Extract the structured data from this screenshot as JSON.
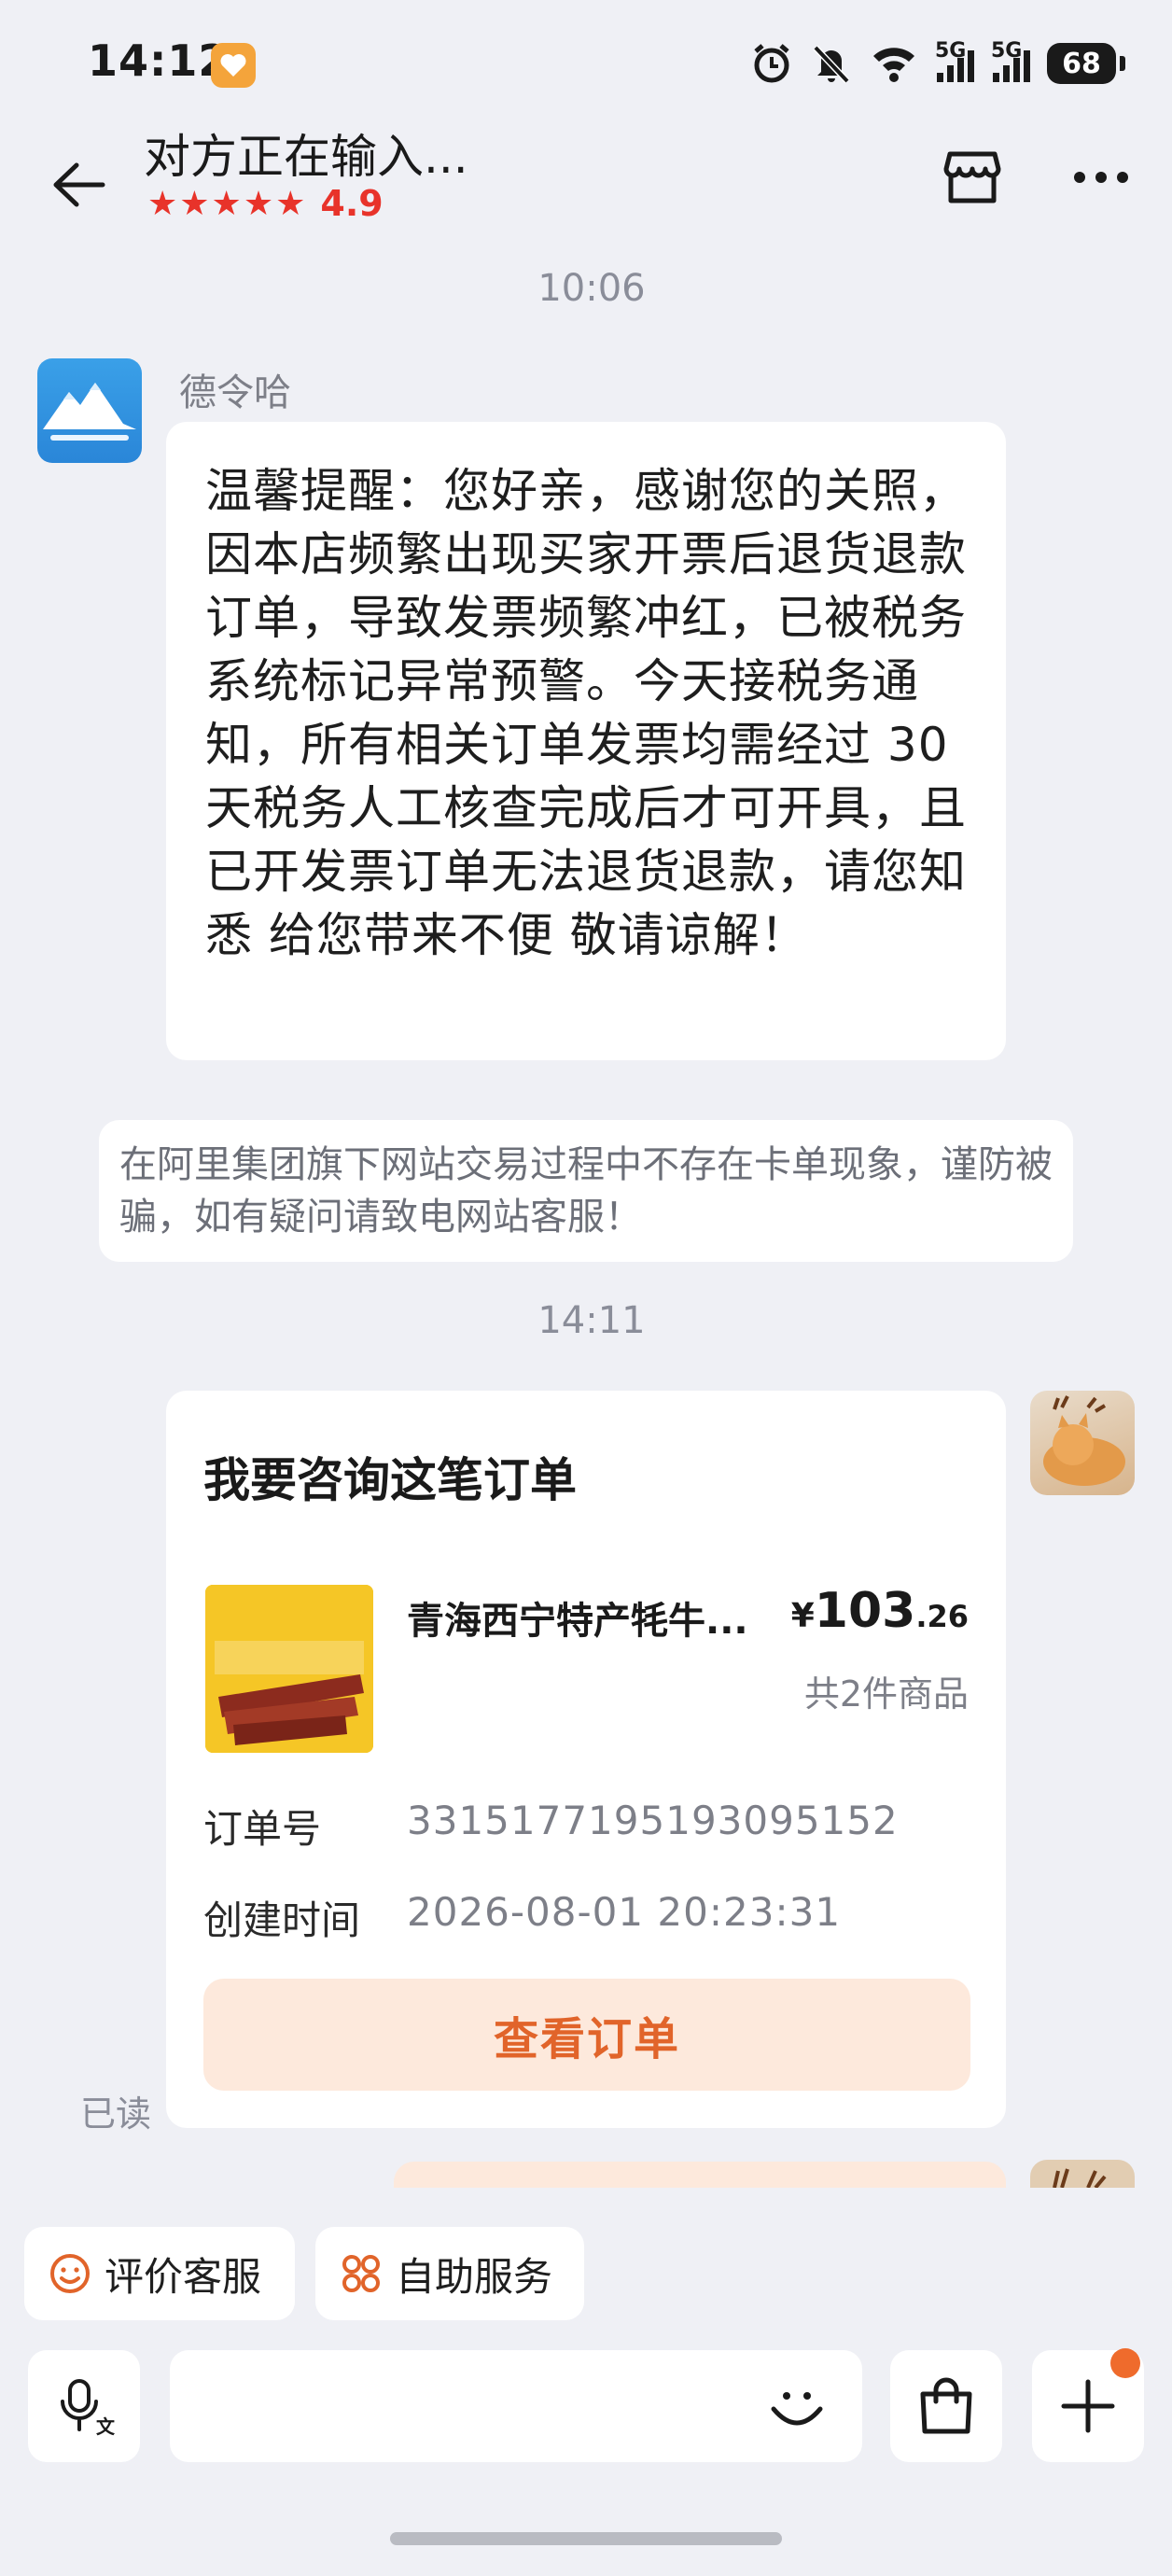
{
  "status_bar": {
    "time": "14:12",
    "network_1": "5G",
    "network_2": "5G",
    "battery": "68"
  },
  "header": {
    "title": "对方正在输入...",
    "stars": "★★★★★",
    "rating": "4.9"
  },
  "chat": {
    "timestamp_1": "10:06",
    "shop_name": "德令哈",
    "message": "温馨提醒：您好亲，感谢您的关照，因本店频繁出现买家开票后退货退款订单，导致发票频繁冲红，已被税务系统标记异常预警。今天接税务通知，所有相关订单发票均需经过 30 天税务人工核查完成后才可开具，且已开发票订单无法退货退款，请您知悉 给您带来不便 敬请谅解！",
    "notice": "在阿里集团旗下网站交易过程中不存在卡单现象，谨防被骗，如有疑问请致电网站客服！",
    "timestamp_2": "14:11",
    "read_status": "已读"
  },
  "order_card": {
    "title": "我要咨询这笔订单",
    "product_name": "青海西宁特产牦牛...",
    "price_currency": "¥",
    "price_int": "103",
    "price_dec": ".26",
    "item_count": "共2件商品",
    "order_no_label": "订单号",
    "order_no": "3315177195193095152",
    "created_label": "创建时间",
    "created_time": "2026-08-01 20:23:31",
    "button": "查看订单"
  },
  "quick_actions": {
    "rate": "评价客服",
    "self_service": "自助服务"
  },
  "input": {
    "placeholder": ""
  },
  "colors": {
    "accent": "#e1642a",
    "rating": "#e8332a",
    "background": "#eff0f5"
  }
}
